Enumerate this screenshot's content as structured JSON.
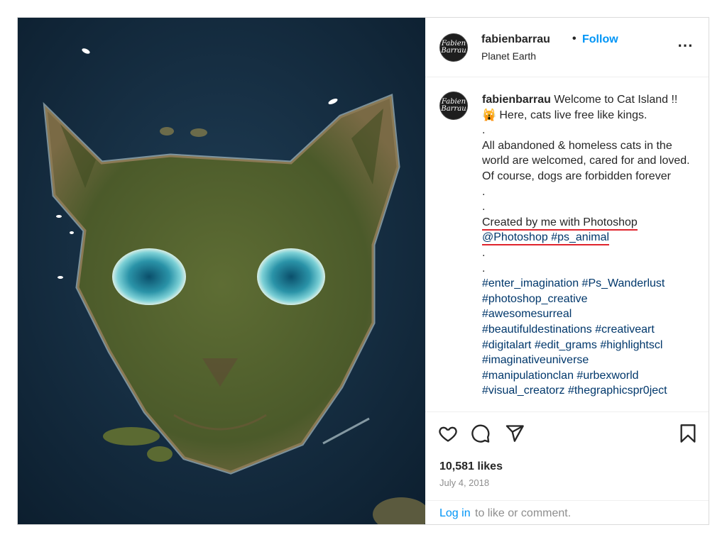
{
  "post": {
    "author": {
      "username": "fabienbarrau",
      "separator": "•",
      "follow_label": "Follow",
      "location": "Planet Earth",
      "avatar_text_line1": "Fabien",
      "avatar_text_line2": "Barrau"
    },
    "more_icon": "⋯",
    "caption": {
      "username": "fabienbarrau",
      "first_text": " Welcome to Cat Island !!",
      "emoji": "🙀",
      "line2": " Here, cats live free like kings.",
      "dot1": ".",
      "line3": "All abandoned & homeless cats in the world are welcomed, cared for and loved.",
      "line4": "Of course, dogs are forbidden forever",
      "dot2": ".",
      "dot3": ".",
      "line5": "Created by me with Photoshop",
      "mention": "@Photoshop",
      "hashtag_ps_animal": "#ps_animal",
      "dot4": ".",
      "dot5": ".",
      "hashtags": [
        "#enter_imagination #Ps_Wanderlust",
        "#photoshop_creative",
        "#awesomesurreal",
        "#beautifuldestinations #creativeart",
        "#digitalart #edit_grams #highlightscl",
        "#imaginativeuniverse",
        "#manipulationclan #urbexworld",
        "#visual_creatorz #thegraphicspr0ject"
      ]
    },
    "actions": {
      "like_icon": "heart-icon",
      "comment_icon": "comment-icon",
      "share_icon": "share-icon",
      "save_icon": "bookmark-icon"
    },
    "likes": "10,581 likes",
    "date": "July 4, 2018",
    "footer": {
      "login_label": "Log in",
      "rest_text": "to like or comment."
    },
    "colors": {
      "link": "#0095f6",
      "hashtag": "#00376b",
      "underline_annotation": "#e0242d",
      "ocean": "#132a3e",
      "island": "#5b6a32"
    }
  }
}
